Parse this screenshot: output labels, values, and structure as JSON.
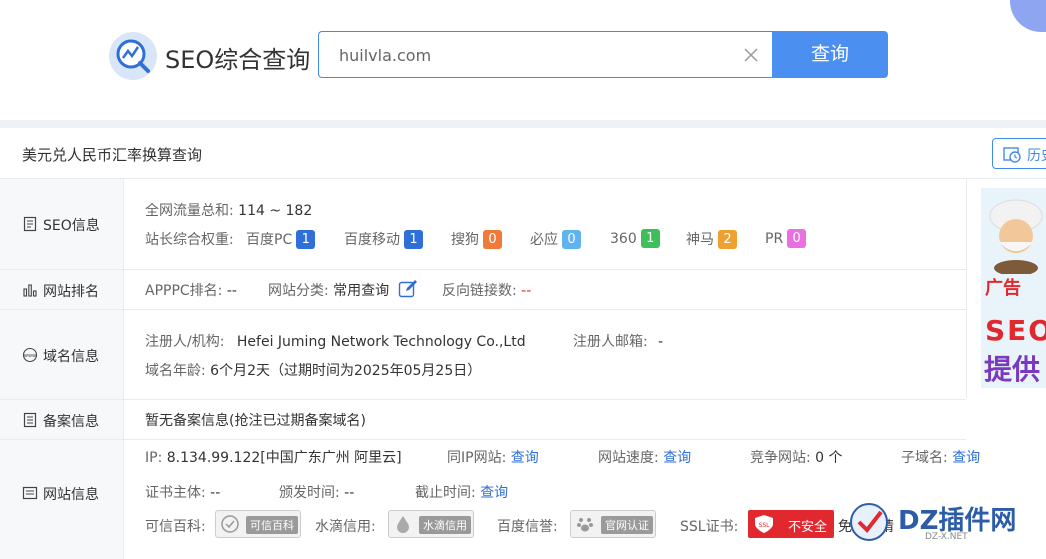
{
  "header": {
    "logo_text": "SEO综合查询",
    "search_value": "huilvla.com",
    "search_button": "查询"
  },
  "page": {
    "title": "美元兑人民币汇率换算查询",
    "history_label": "历史"
  },
  "seo_info": {
    "label": "SEO信息",
    "traffic_label": "全网流量总和:",
    "traffic_value": "114 ~ 182",
    "weight_label": "站长综合权重:",
    "weights": [
      {
        "name": "百度PC",
        "value": "1",
        "color": "#2f6fd8"
      },
      {
        "name": "百度移动",
        "value": "1",
        "color": "#2f6fd8"
      },
      {
        "name": "搜狗",
        "value": "0",
        "color": "#f07a3a"
      },
      {
        "name": "必应",
        "value": "0",
        "color": "#5fb4f0"
      },
      {
        "name": "360",
        "value": "1",
        "color": "#3fbf5a"
      },
      {
        "name": "神马",
        "value": "2",
        "color": "#f0a030"
      },
      {
        "name": "PR",
        "value": "0",
        "color": "#e870e0"
      }
    ]
  },
  "rank": {
    "label": "网站排名",
    "apppc_label": "APPPC排名:",
    "apppc_value": "--",
    "category_label": "网站分类:",
    "category_value": "常用查询",
    "backlinks_label": "反向链接数:",
    "backlinks_value": "--"
  },
  "domain": {
    "label": "域名信息",
    "registrant_label": "注册人/机构:",
    "registrant_value": "Hefei Juming Network Technology Co.,Ltd",
    "email_label": "注册人邮箱:",
    "email_value": "-",
    "age_label": "域名年龄:",
    "age_value": "6个月2天（过期时间为2025年05月25日）"
  },
  "icp": {
    "label": "备案信息",
    "value": "暂无备案信息(抢注已过期备案域名)"
  },
  "site": {
    "label": "网站信息",
    "ip_label": "IP:",
    "ip_value": "8.134.99.122[中国广东广州 阿里云]",
    "same_ip_label": "同IP网站:",
    "same_ip_link": "查询",
    "speed_label": "网站速度:",
    "speed_link": "查询",
    "competitor_label": "竞争网站:",
    "competitor_value": "0 个",
    "subdomain_label": "子域名:",
    "subdomain_link": "查询",
    "cert_subject_label": "证书主体:",
    "cert_subject_value": "--",
    "issued_label": "颁发时间:",
    "issued_value": "--",
    "expire_label": "截止时间:",
    "expire_link": "查询",
    "kexin_label": "可信百科:",
    "kexin_pill": "可信百科",
    "shuidi_label": "水滴信用:",
    "shuidi_pill": "水滴信用",
    "baidu_label": "百度信誉:",
    "baidu_pill": "官网认证",
    "ssl_label": "SSL证书:",
    "ssl_badge": "不安全",
    "ssl_apply": "免费申请"
  },
  "ad": {
    "label": "广告",
    "line1": "SEO",
    "line2": "提供"
  },
  "watermark": {
    "text": "DZ插件网",
    "sub": "DZ-X.NET"
  }
}
